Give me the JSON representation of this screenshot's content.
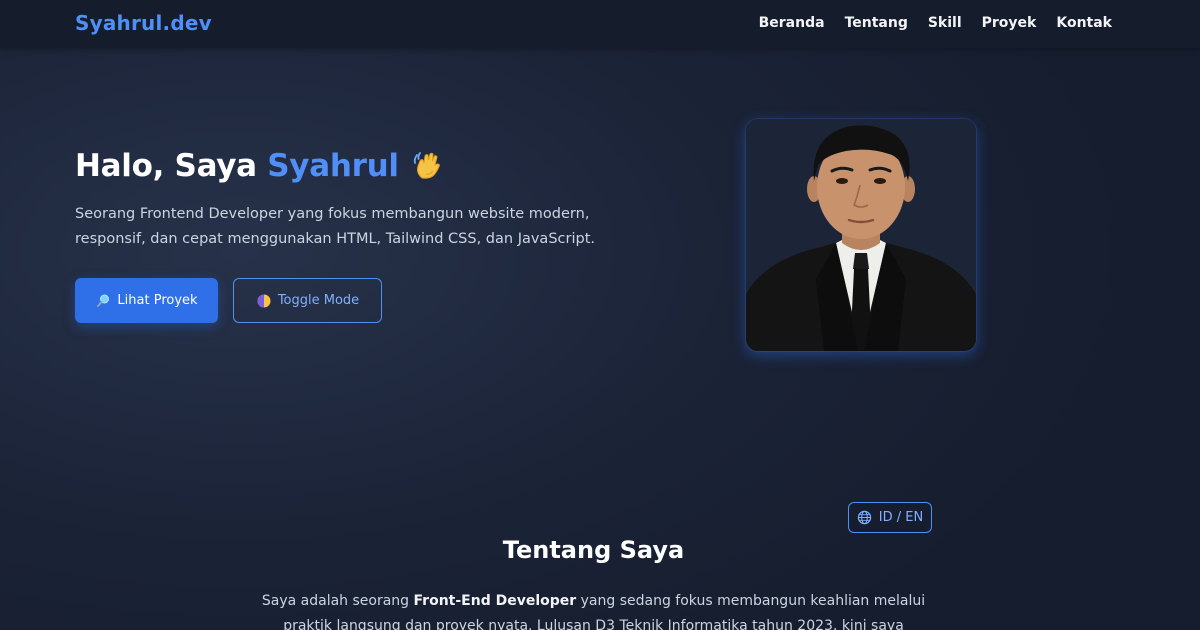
{
  "navbar": {
    "brand": "Syahrul.dev",
    "links": [
      "Beranda",
      "Tentang",
      "Skill",
      "Proyek",
      "Kontak"
    ]
  },
  "hero": {
    "greeting": "Halo, Saya ",
    "name": "Syahrul",
    "wave_icon": "waving-hand",
    "description": "Seorang Frontend Developer yang fokus membangun website modern, responsif, dan cepat menggunakan HTML, Tailwind CSS, dan JavaScript.",
    "primary_button": "Lihat Proyek",
    "primary_button_icon": "magnifier",
    "secondary_button": "Toggle Mode",
    "secondary_button_icon": "half-moon",
    "photo_alt": "profile-photo"
  },
  "about": {
    "lang_toggle": "ID / EN",
    "lang_icon": "globe",
    "title": "Tentang Saya",
    "text_before": "Saya adalah seorang ",
    "text_bold": "Front-End Developer",
    "text_after": " yang sedang fokus membangun keahlian melalui praktik langsung dan proyek nyata. Lulusan D3 Teknik Informatika tahun 2023, kini saya"
  },
  "colors": {
    "accent": "#4f8ff7",
    "background": "#1b2337",
    "navbar": "#151c2c",
    "button": "#2f6fe8"
  }
}
